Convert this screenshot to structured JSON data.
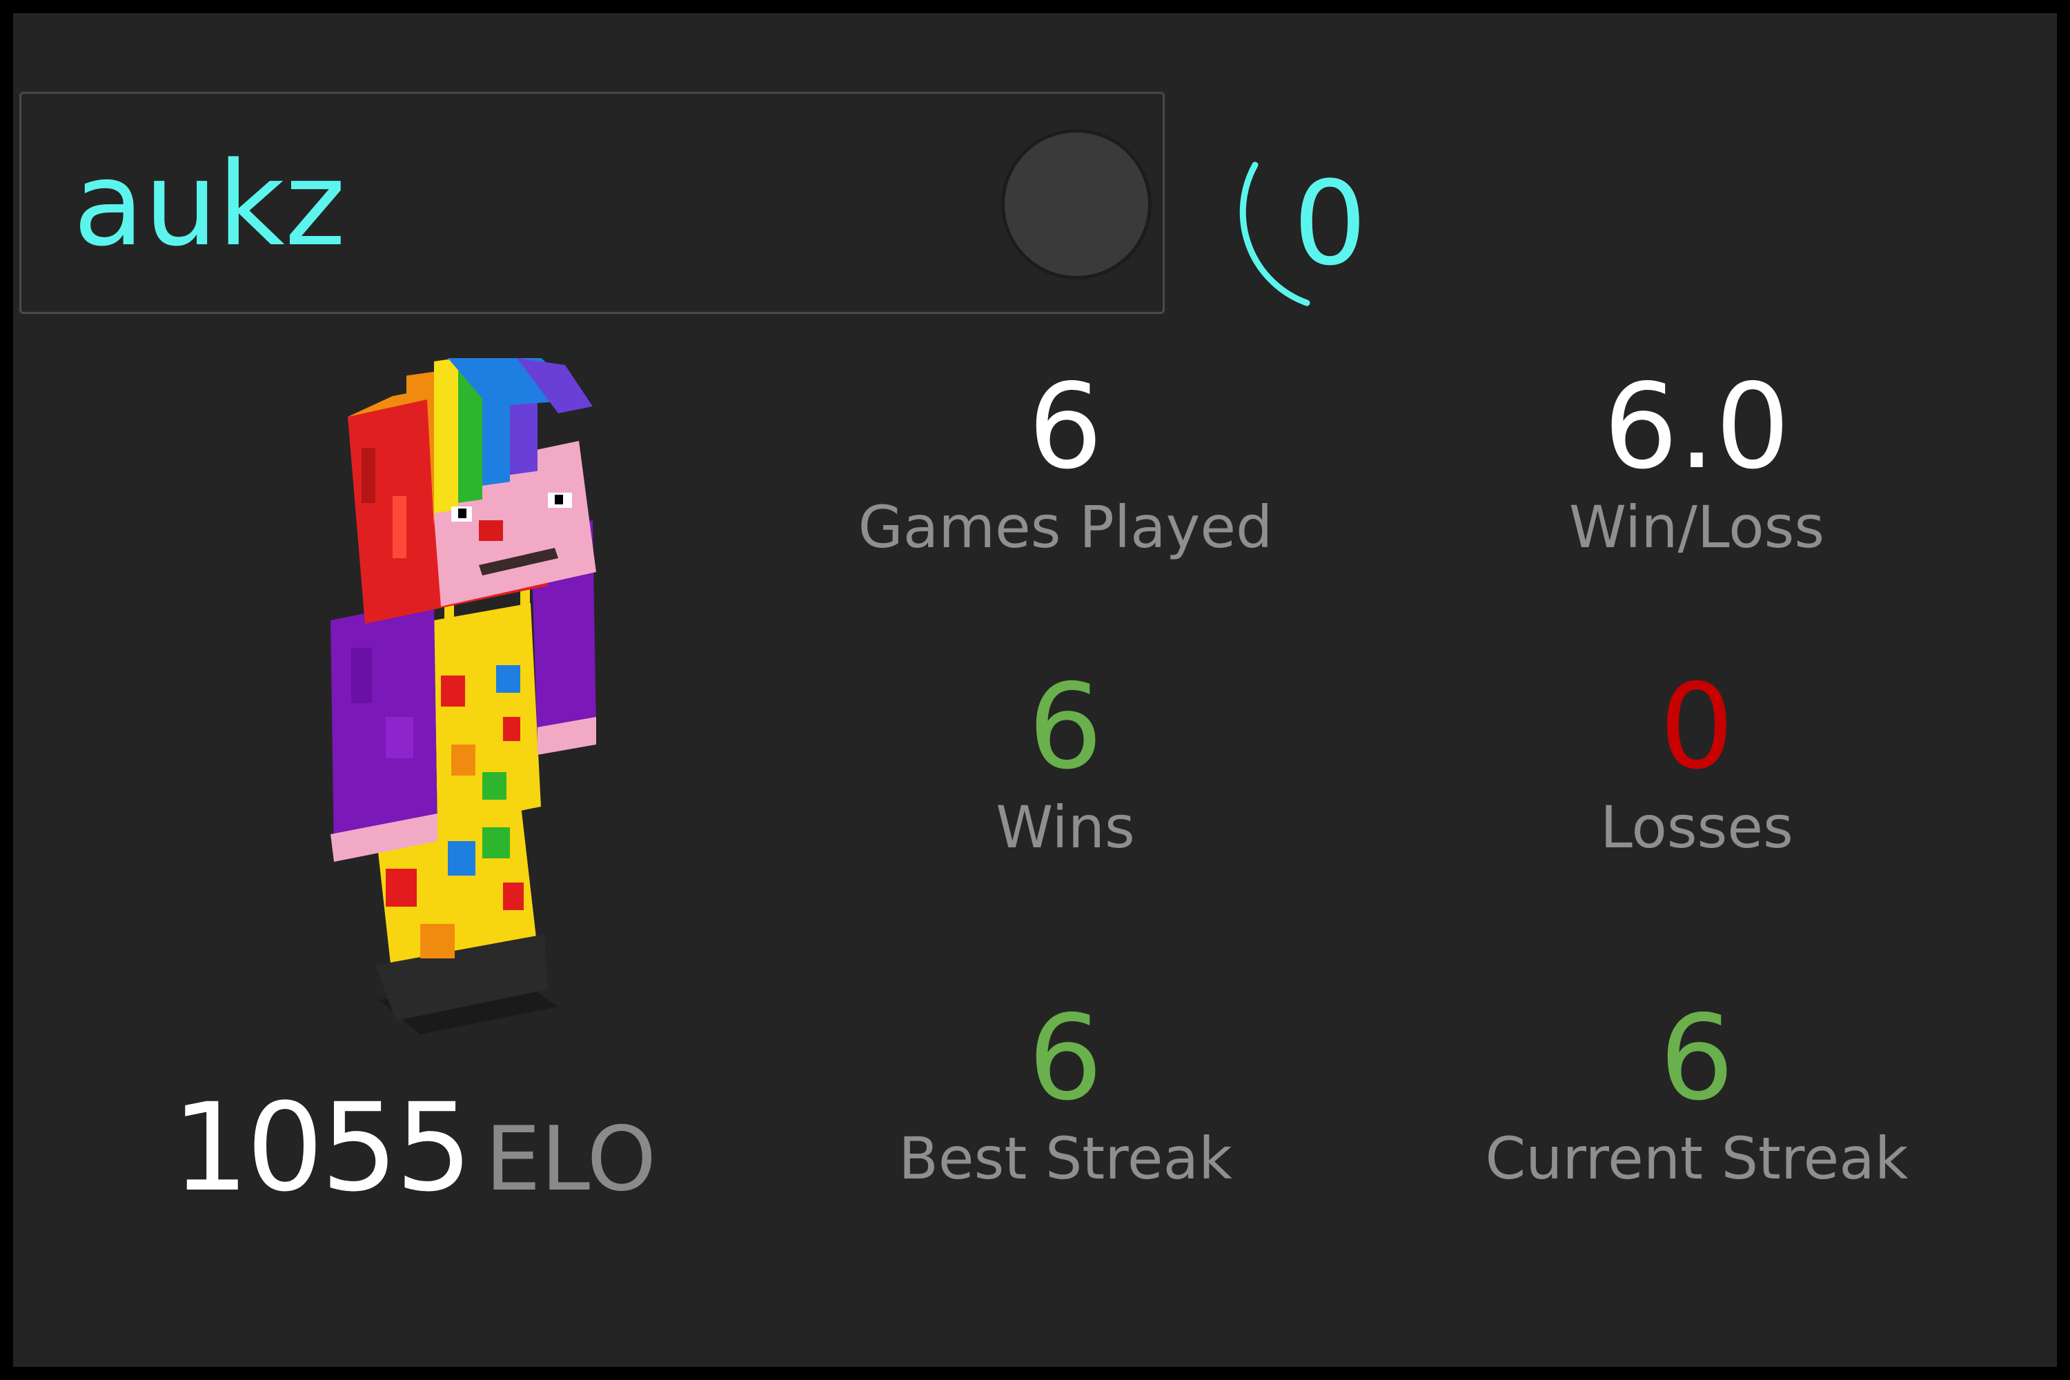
{
  "player": {
    "username": "aukz",
    "rank_value": "0",
    "elo_value": "1055",
    "elo_label": "ELO",
    "avatar_icon": "minecraft-clown-skin-icon"
  },
  "stats": {
    "games_played": {
      "value": "6",
      "label": "Games Played"
    },
    "win_loss": {
      "value": "6.0",
      "label": "Win/Loss"
    },
    "wins": {
      "value": "6",
      "label": "Wins"
    },
    "losses": {
      "value": "0",
      "label": "Losses"
    },
    "best_streak": {
      "value": "6",
      "label": "Best Streak"
    },
    "current_streak": {
      "value": "6",
      "label": "Current Streak"
    }
  },
  "colors": {
    "background": "#242424",
    "accent_cyan": "#5cf5ee",
    "win_green": "#6ab04c",
    "loss_red": "#c80000",
    "label_gray": "#8f8f8f"
  }
}
